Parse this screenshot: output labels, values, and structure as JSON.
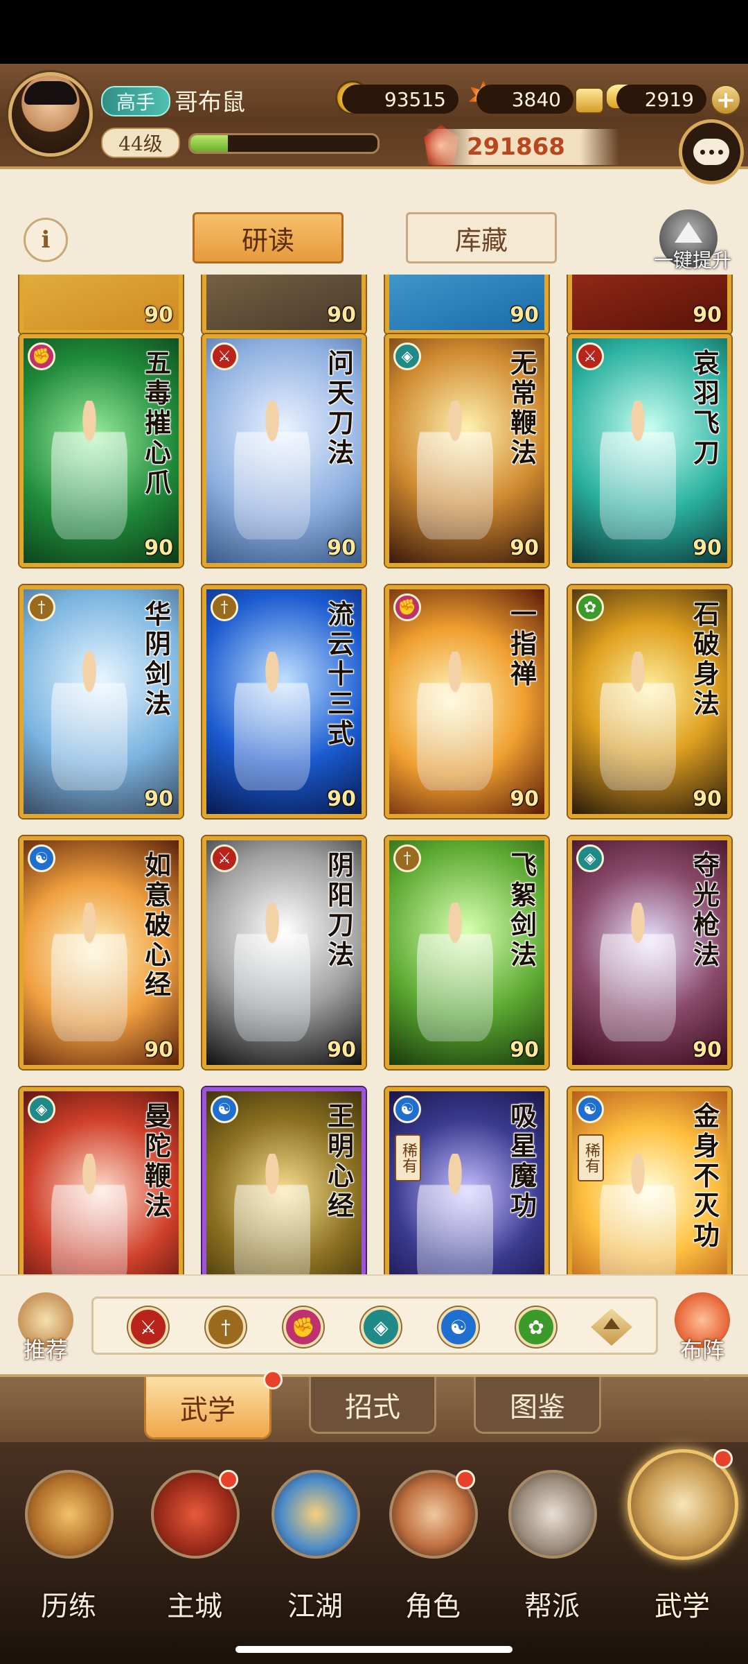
{
  "player": {
    "rank": "高手",
    "name": "哥布鼠",
    "level": "44级",
    "exp_fraction": 0.2
  },
  "currencies": {
    "coins": "93515",
    "ember": "3840",
    "ingots": "2919",
    "power": "291868"
  },
  "tabs": {
    "study": "研读",
    "collection": "库藏",
    "upgrade_all": "一键提升"
  },
  "cards": [
    {
      "title": "",
      "level": "90",
      "type": "sword",
      "partial": true
    },
    {
      "title": "",
      "level": "90",
      "type": "blade",
      "partial": true
    },
    {
      "title": "",
      "level": "90",
      "type": "fan",
      "partial": true
    },
    {
      "title": "",
      "level": "90",
      "type": "blade",
      "partial": true
    },
    {
      "title": "五毒摧心爪",
      "level": "90",
      "type": "fist"
    },
    {
      "title": "问天刀法",
      "level": "90",
      "type": "blade"
    },
    {
      "title": "无常鞭法",
      "level": "90",
      "type": "fan"
    },
    {
      "title": "哀羽飞刀",
      "level": "90",
      "type": "blade"
    },
    {
      "title": "华阴剑法",
      "level": "90",
      "type": "sword"
    },
    {
      "title": "流云十三式",
      "level": "90",
      "type": "sword"
    },
    {
      "title": "一指禅",
      "level": "90",
      "type": "fist"
    },
    {
      "title": "石破身法",
      "level": "90",
      "type": "leaf"
    },
    {
      "title": "如意破心经",
      "level": "90",
      "type": "taiji"
    },
    {
      "title": "阴阳刀法",
      "level": "90",
      "type": "blade"
    },
    {
      "title": "飞絮剑法",
      "level": "90",
      "type": "sword"
    },
    {
      "title": "夺光枪法",
      "level": "90",
      "type": "fan"
    },
    {
      "title": "曼陀鞭法",
      "level": "",
      "type": "fan"
    },
    {
      "title": "王明心经",
      "level": "",
      "type": "taiji",
      "purple": true
    },
    {
      "title": "吸星魔功",
      "level": "",
      "type": "taiji",
      "rare": "稀有"
    },
    {
      "title": "金身不灭功",
      "level": "",
      "type": "taiji",
      "rare": "稀有"
    }
  ],
  "filter": {
    "recommend": "推荐",
    "formation": "布阵",
    "icons": [
      "blade-filter-icon",
      "sword-filter-icon",
      "fist-filter-icon",
      "fan-filter-icon",
      "taiji-filter-icon",
      "leaf-filter-icon"
    ]
  },
  "subtabs": [
    "武学",
    "招式",
    "图鉴"
  ],
  "nav": [
    "历练",
    "主城",
    "江湖",
    "角色",
    "帮派",
    "武学"
  ],
  "colors": {
    "blade": "#b8241c",
    "sword": "#9a6a1e",
    "fist": "#c0306e",
    "fan": "#1f8a88",
    "taiji": "#1f6fd0",
    "leaf": "#3a9a2a"
  }
}
